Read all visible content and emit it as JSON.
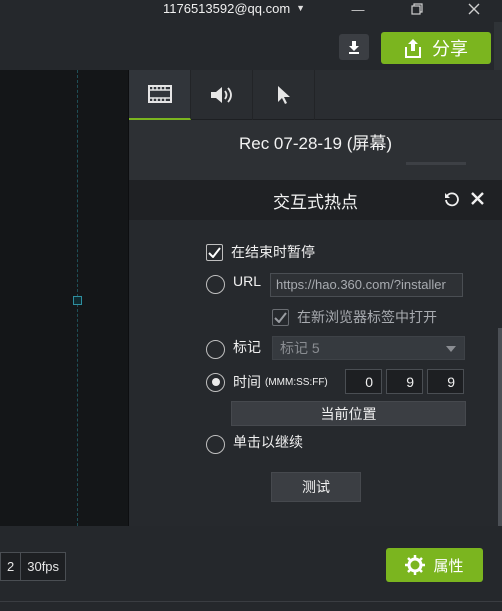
{
  "titlebar": {
    "account": "1176513592@qq.com"
  },
  "toolbar": {
    "share_label": "分享"
  },
  "panel": {
    "tabs": [
      {
        "icon": "film-icon"
      },
      {
        "icon": "speaker-icon"
      },
      {
        "icon": "cursor-icon"
      }
    ],
    "media_title": "Rec 07-28-19 (屏幕)",
    "section_title": "交互式热点",
    "options": {
      "pause_at_end": {
        "label": "在结束时暂停",
        "checked": true
      },
      "url": {
        "label": "URL",
        "value": "https://hao.360.com/?installer",
        "selected": false
      },
      "open_new_tab": {
        "label": "在新浏览器标签中打开",
        "checked": true
      },
      "marker": {
        "label": "标记",
        "value": "标记 5",
        "selected": false
      },
      "time": {
        "label": "时间",
        "format": "(MMM:SS:FF)",
        "selected": true,
        "values": [
          "0",
          "9",
          "9"
        ]
      },
      "current_position_label": "当前位置",
      "click_continue": {
        "label": "单击以继续",
        "selected": false
      }
    },
    "test_label": "测试"
  },
  "bottom": {
    "fps_prefix": "2",
    "fps": "30fps",
    "properties_label": "属性"
  },
  "colors": {
    "accent": "#7bb51f",
    "background": "#1e2023"
  }
}
